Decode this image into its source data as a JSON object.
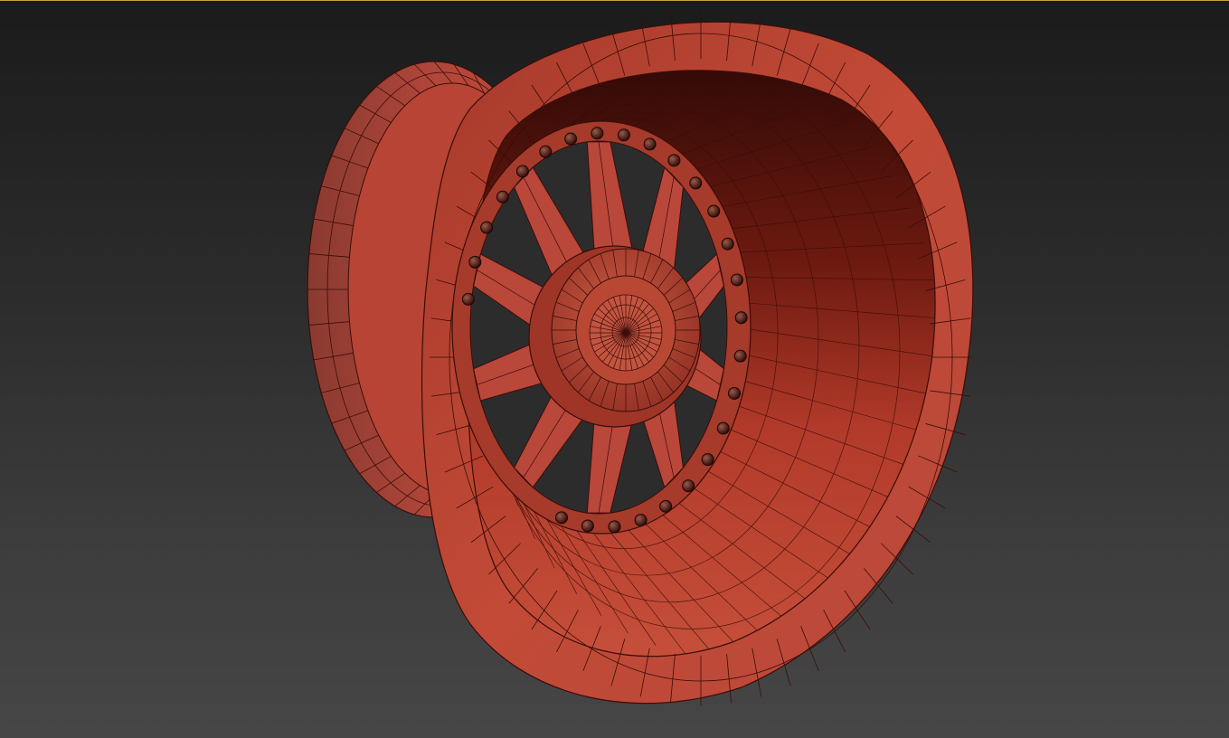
{
  "viewport": {
    "kind": "3d-viewport",
    "shading": "edged-faces",
    "active_border_color": "#c9a23a",
    "background_top": "#1b1b1b",
    "background_bottom": "#464646"
  },
  "model": {
    "object": "wheel-rim",
    "material_color": "#b8402f",
    "wire_color": "#3a0d08",
    "spokes": 10,
    "bolts": 26
  }
}
